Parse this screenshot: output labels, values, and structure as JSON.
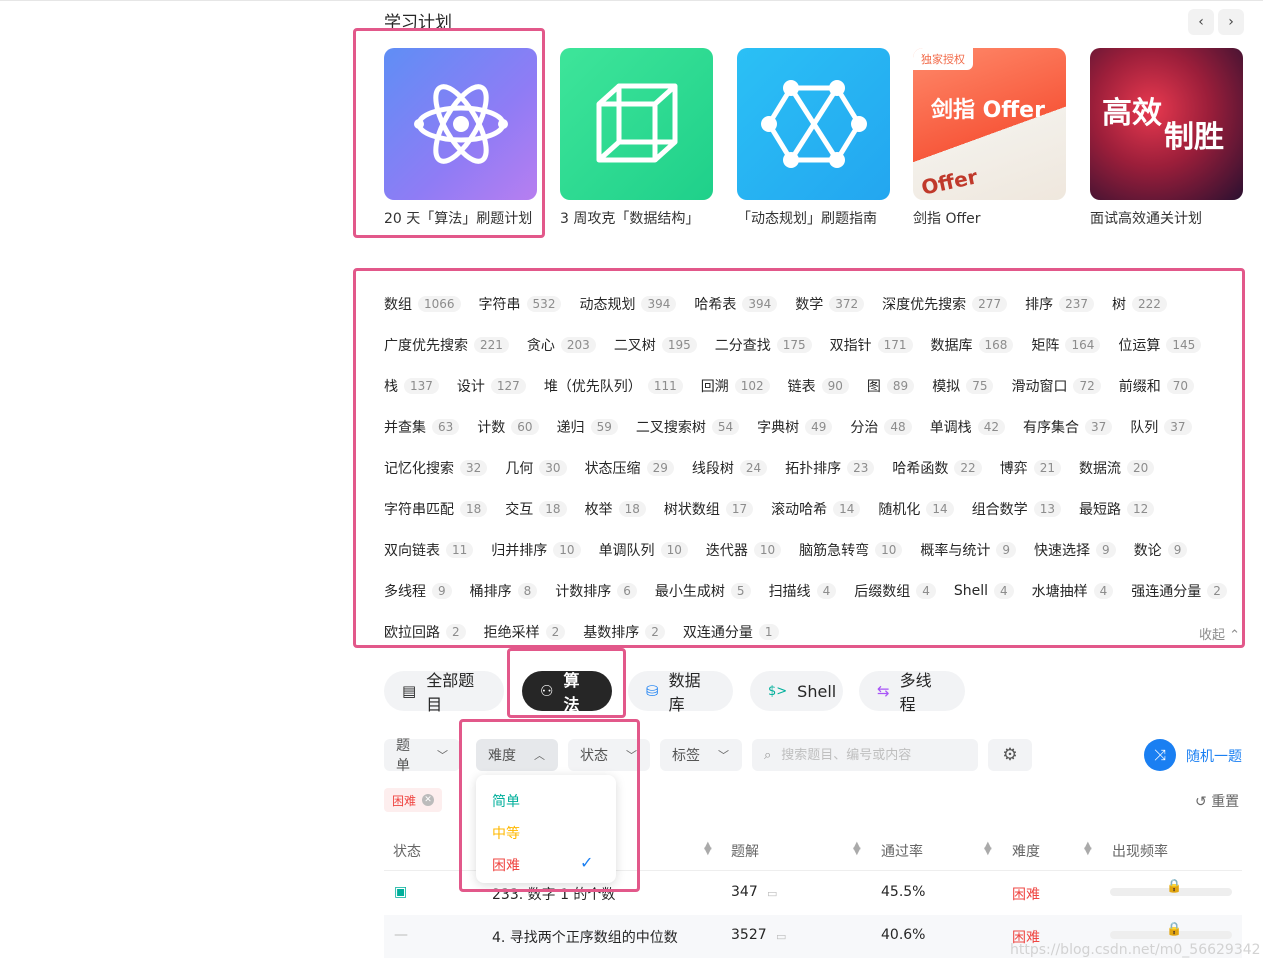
{
  "study_plan": {
    "title": "学习计划",
    "prev_icon": "‹",
    "next_icon": "›",
    "cards": [
      {
        "caption": "20 天「算法」刷题计划",
        "icon": "atom-icon"
      },
      {
        "caption": "3 周攻克「数据结构」",
        "icon": "cube-icon"
      },
      {
        "caption": "「动态规划」刷题指南",
        "icon": "graph-network-icon"
      },
      {
        "caption": "剑指 Offer",
        "badge": "独家授权",
        "banner": "剑指 Offer",
        "book_text": "Offer"
      },
      {
        "caption": "面试高效通关计划",
        "banner_line1": "高效",
        "banner_line2": "制胜"
      }
    ]
  },
  "tags": {
    "rows": [
      [
        {
          "name": "数组",
          "count": "1066"
        },
        {
          "name": "字符串",
          "count": "532"
        },
        {
          "name": "动态规划",
          "count": "394"
        },
        {
          "name": "哈希表",
          "count": "394"
        },
        {
          "name": "数学",
          "count": "372"
        },
        {
          "name": "深度优先搜索",
          "count": "277"
        },
        {
          "name": "排序",
          "count": "237"
        },
        {
          "name": "树",
          "count": "222"
        }
      ],
      [
        {
          "name": "广度优先搜索",
          "count": "221"
        },
        {
          "name": "贪心",
          "count": "203"
        },
        {
          "name": "二叉树",
          "count": "195"
        },
        {
          "name": "二分查找",
          "count": "175"
        },
        {
          "name": "双指针",
          "count": "171"
        },
        {
          "name": "数据库",
          "count": "168"
        },
        {
          "name": "矩阵",
          "count": "164"
        },
        {
          "name": "位运算",
          "count": "145"
        }
      ],
      [
        {
          "name": "栈",
          "count": "137"
        },
        {
          "name": "设计",
          "count": "127"
        },
        {
          "name": "堆（优先队列）",
          "count": "111"
        },
        {
          "name": "回溯",
          "count": "102"
        },
        {
          "name": "链表",
          "count": "90"
        },
        {
          "name": "图",
          "count": "89"
        },
        {
          "name": "模拟",
          "count": "75"
        },
        {
          "name": "滑动窗口",
          "count": "72"
        },
        {
          "name": "前缀和",
          "count": "70"
        }
      ],
      [
        {
          "name": "并查集",
          "count": "63"
        },
        {
          "name": "计数",
          "count": "60"
        },
        {
          "name": "递归",
          "count": "59"
        },
        {
          "name": "二叉搜索树",
          "count": "54"
        },
        {
          "name": "字典树",
          "count": "49"
        },
        {
          "name": "分治",
          "count": "48"
        },
        {
          "name": "单调栈",
          "count": "42"
        },
        {
          "name": "有序集合",
          "count": "37"
        },
        {
          "name": "队列",
          "count": "37"
        }
      ],
      [
        {
          "name": "记忆化搜索",
          "count": "32"
        },
        {
          "name": "几何",
          "count": "30"
        },
        {
          "name": "状态压缩",
          "count": "29"
        },
        {
          "name": "线段树",
          "count": "24"
        },
        {
          "name": "拓扑排序",
          "count": "23"
        },
        {
          "name": "哈希函数",
          "count": "22"
        },
        {
          "name": "博弈",
          "count": "21"
        },
        {
          "name": "数据流",
          "count": "20"
        }
      ],
      [
        {
          "name": "字符串匹配",
          "count": "18"
        },
        {
          "name": "交互",
          "count": "18"
        },
        {
          "name": "枚举",
          "count": "18"
        },
        {
          "name": "树状数组",
          "count": "17"
        },
        {
          "name": "滚动哈希",
          "count": "14"
        },
        {
          "name": "随机化",
          "count": "14"
        },
        {
          "name": "组合数学",
          "count": "13"
        },
        {
          "name": "最短路",
          "count": "12"
        }
      ],
      [
        {
          "name": "双向链表",
          "count": "11"
        },
        {
          "name": "归并排序",
          "count": "10"
        },
        {
          "name": "单调队列",
          "count": "10"
        },
        {
          "name": "迭代器",
          "count": "10"
        },
        {
          "name": "脑筋急转弯",
          "count": "10"
        },
        {
          "name": "概率与统计",
          "count": "9"
        },
        {
          "name": "快速选择",
          "count": "9"
        },
        {
          "name": "数论",
          "count": "9"
        }
      ],
      [
        {
          "name": "多线程",
          "count": "9"
        },
        {
          "name": "桶排序",
          "count": "8"
        },
        {
          "name": "计数排序",
          "count": "6"
        },
        {
          "name": "最小生成树",
          "count": "5"
        },
        {
          "name": "扫描线",
          "count": "4"
        },
        {
          "name": "后缀数组",
          "count": "4"
        },
        {
          "name": "Shell",
          "count": "4"
        },
        {
          "name": "水塘抽样",
          "count": "4"
        },
        {
          "name": "强连通分量",
          "count": "2"
        }
      ],
      [
        {
          "name": "欧拉回路",
          "count": "2"
        },
        {
          "name": "拒绝采样",
          "count": "2"
        },
        {
          "name": "基数排序",
          "count": "2"
        },
        {
          "name": "双连通分量",
          "count": "1"
        }
      ]
    ],
    "collapse_label": "收起 ⌃"
  },
  "categories": [
    {
      "label": "全部题目",
      "icon": "▤"
    },
    {
      "label": "算法",
      "icon": "⚇"
    },
    {
      "label": "数据库",
      "icon": "⛁"
    },
    {
      "label": "Shell",
      "icon": "$>"
    },
    {
      "label": "多线程",
      "icon": "⇆"
    }
  ],
  "filters": {
    "list": "题单",
    "difficulty": "难度",
    "status": "状态",
    "tags": "标签",
    "search_placeholder": "搜索题目、编号或内容",
    "random_label": "随机一题",
    "reset_label": "重置",
    "active_chip": "困难"
  },
  "difficulty_menu": {
    "easy": "简单",
    "medium": "中等",
    "hard": "困难",
    "selected": "hard",
    "colors": {
      "easy": "#00af9b",
      "medium": "#ffb800",
      "hard": "#ef4743"
    }
  },
  "table": {
    "headers": {
      "status": "状态",
      "solutions": "题解",
      "acceptance": "通过率",
      "difficulty": "难度",
      "frequency": "出现频率"
    },
    "rows": [
      {
        "status_icon": "calendar-icon",
        "title": "233. 数字 1 的个数",
        "solutions": "347",
        "acceptance": "45.5%",
        "difficulty": "困难"
      },
      {
        "status_icon": "dash",
        "status_text": "—",
        "title": "4. 寻找两个正序数组的中位数",
        "solutions": "3527",
        "acceptance": "40.6%",
        "difficulty": "困难"
      }
    ]
  },
  "watermark": "https://blog.csdn.net/m0_56629342"
}
